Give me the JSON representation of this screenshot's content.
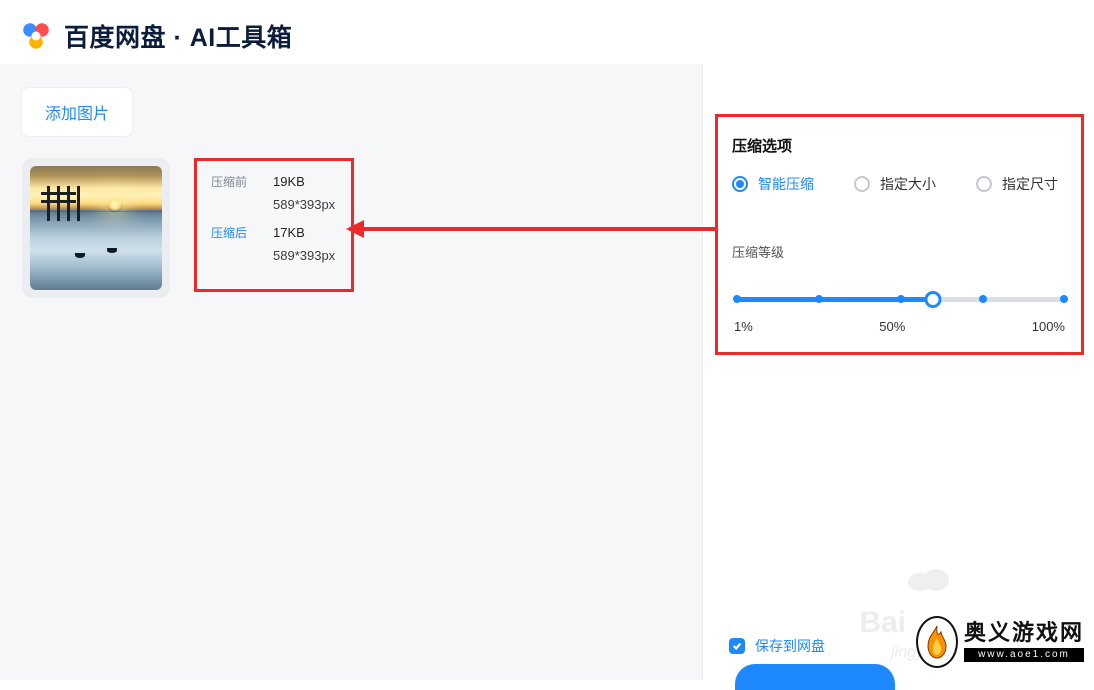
{
  "header": {
    "title": "百度网盘 · AI工具箱"
  },
  "left": {
    "add_button": "添加图片",
    "info": {
      "before_label": "压缩前",
      "before_size": "19KB",
      "before_dim": "589*393px",
      "after_label": "压缩后",
      "after_size": "17KB",
      "after_dim": "589*393px"
    }
  },
  "right": {
    "panel_title": "压缩选项",
    "options": {
      "smart": "智能压缩",
      "size": "指定大小",
      "dimension": "指定尺寸",
      "selected": "smart"
    },
    "level_label": "压缩等级",
    "slider": {
      "value_percent": 60,
      "label_min": "1%",
      "label_mid": "50%",
      "label_max": "100%"
    },
    "save_label": "保存到网盘",
    "save_checked": true
  },
  "watermark": {
    "bai": "Bai",
    "jingy": "jingy",
    "brand_zh": "奥义游戏网",
    "brand_en": "www.aoe1.com"
  }
}
